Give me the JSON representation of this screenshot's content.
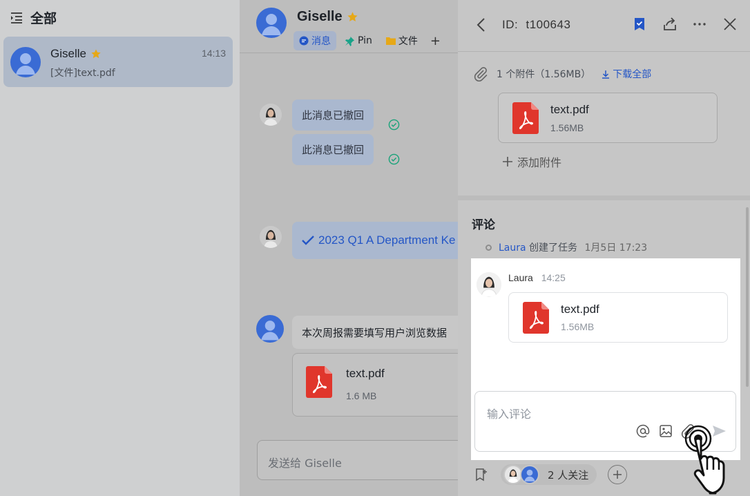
{
  "sidebar": {
    "title": "全部",
    "conversation": {
      "name": "Giselle",
      "time": "14:13",
      "preview": "[文件]text.pdf"
    }
  },
  "chat": {
    "name": "Giselle",
    "tabs": [
      {
        "label": "消息",
        "icon": "message-icon",
        "active": true
      },
      {
        "label": "Pin",
        "icon": "pin-icon",
        "active": false
      },
      {
        "label": "文件",
        "icon": "folder-icon",
        "active": false
      }
    ],
    "add_tab": "+",
    "messages": {
      "recalled_1": "此消息已撤回",
      "recalled_2": "此消息已撤回",
      "task": "2023 Q1 A Department Ke",
      "report": "本次周报需要填写用户浏览数据",
      "file_name": "text.pdf",
      "file_size": "1.6 MB"
    },
    "input_placeholder": "发送给 Giselle"
  },
  "detail": {
    "id_label": "ID:",
    "id_value": "t100643",
    "attachments_summary": "1 个附件（1.56MB）",
    "download_all": "下载全部",
    "attachment": {
      "name": "text.pdf",
      "size": "1.56MB"
    },
    "add_attachment": "添加附件",
    "comments_title": "评论",
    "activity": {
      "who": "Laura",
      "action": "创建了任务",
      "when": "1月5日 17:23"
    },
    "comment": {
      "author": "Laura",
      "time": "14:25",
      "file_name": "text.pdf",
      "file_size": "1.56MB"
    },
    "comment_placeholder": "输入评论",
    "followers_label": "2 人关注"
  },
  "colors": {
    "accent": "#2456c6",
    "pdf_red": "#e0362c",
    "check_green": "#1aa37a",
    "star": "#e6a817"
  }
}
